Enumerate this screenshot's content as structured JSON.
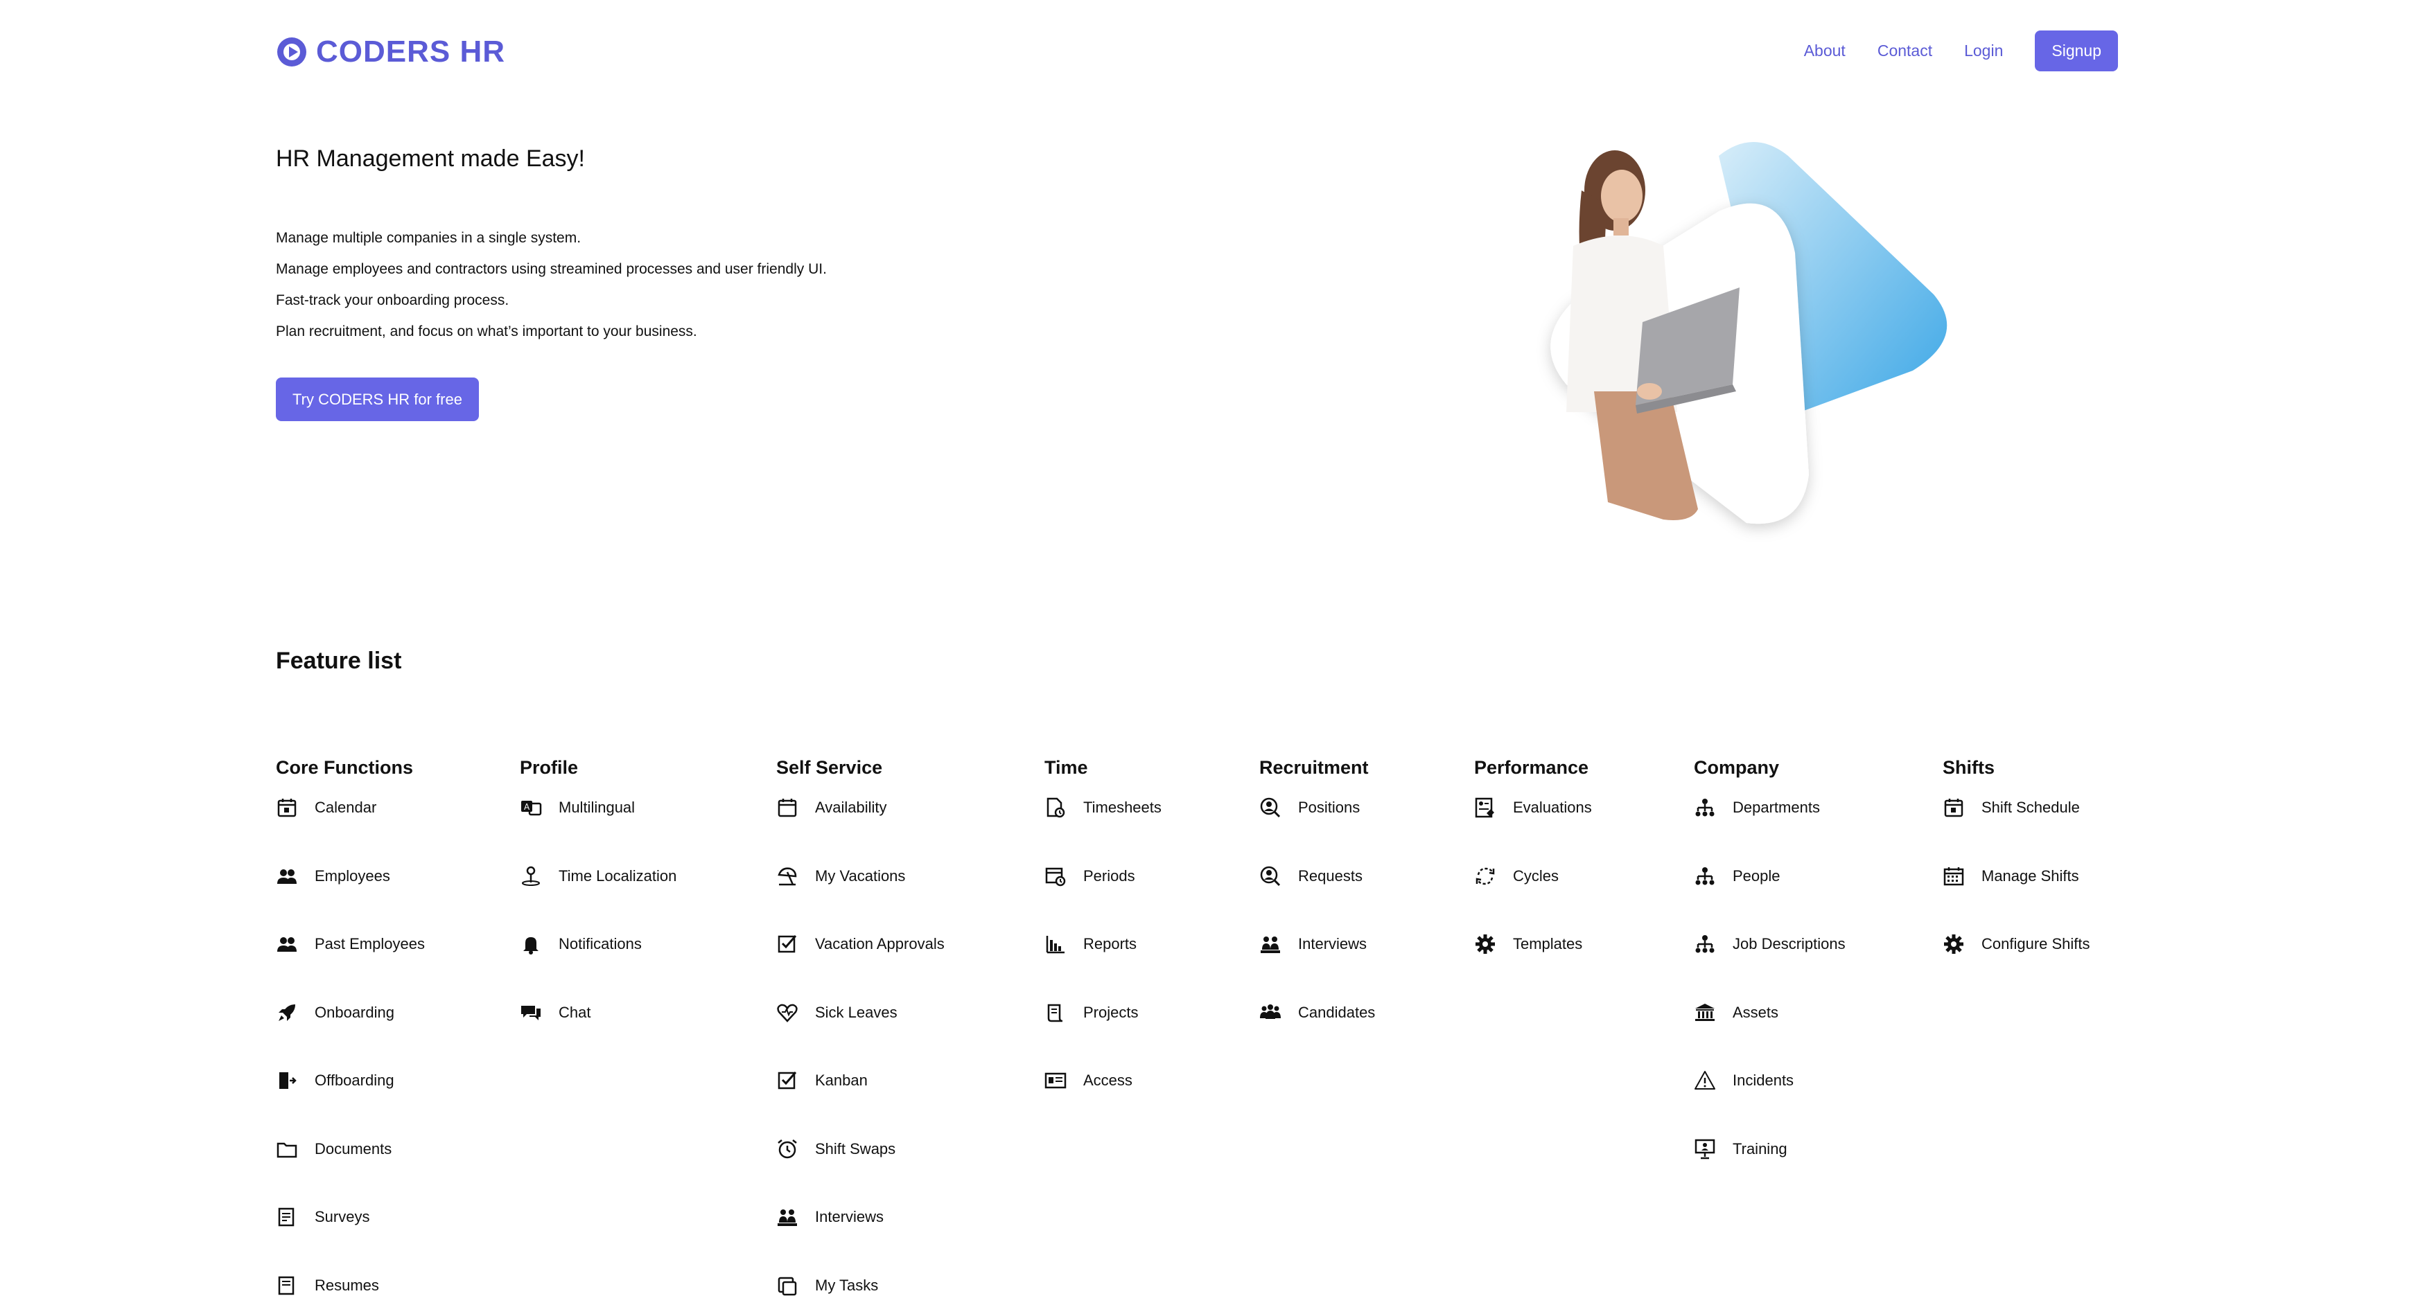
{
  "header": {
    "logo_text": "CODERS HR",
    "nav": [
      {
        "label": "About"
      },
      {
        "label": "Contact"
      },
      {
        "label": "Login"
      }
    ],
    "signup_label": "Signup"
  },
  "hero": {
    "title": "HR Management made Easy!",
    "lines": [
      "Manage multiple companies in a single system.",
      "Manage employees and contractors using streamined processes and user friendly UI.",
      "Fast-track your onboarding process.",
      "Plan recruitment, and focus on what’s important to your business."
    ],
    "cta_label": "Try CODERS HR for free"
  },
  "features": {
    "title": "Feature list",
    "columns": [
      {
        "title": "Core Functions",
        "items": [
          {
            "label": "Calendar",
            "icon": "calendar-icon"
          },
          {
            "label": "Employees",
            "icon": "people-icon"
          },
          {
            "label": "Past Employees",
            "icon": "people-icon"
          },
          {
            "label": "Onboarding",
            "icon": "rocket-icon"
          },
          {
            "label": "Offboarding",
            "icon": "exit-icon"
          },
          {
            "label": "Documents",
            "icon": "folder-icon"
          },
          {
            "label": "Surveys",
            "icon": "survey-icon"
          },
          {
            "label": "Resumes",
            "icon": "document-icon"
          }
        ]
      },
      {
        "title": "Profile",
        "items": [
          {
            "label": "Multilingual",
            "icon": "translate-icon"
          },
          {
            "label": "Time Localization",
            "icon": "location-icon"
          },
          {
            "label": "Notifications",
            "icon": "bell-icon"
          },
          {
            "label": "Chat",
            "icon": "chat-icon"
          }
        ]
      },
      {
        "title": "Self Service",
        "items": [
          {
            "label": "Availability",
            "icon": "calendar-icon"
          },
          {
            "label": "My Vacations",
            "icon": "umbrella-icon"
          },
          {
            "label": "Vacation Approvals",
            "icon": "checkbox-icon"
          },
          {
            "label": "Sick Leaves",
            "icon": "heart-icon"
          },
          {
            "label": "Kanban",
            "icon": "checkbox-icon"
          },
          {
            "label": "Shift Swaps",
            "icon": "alarm-icon"
          },
          {
            "label": "Interviews",
            "icon": "interview-icon"
          },
          {
            "label": "My Tasks",
            "icon": "tasks-icon"
          }
        ]
      },
      {
        "title": "Time",
        "items": [
          {
            "label": "Timesheets",
            "icon": "timesheet-icon"
          },
          {
            "label": "Periods",
            "icon": "calendar-clock-icon"
          },
          {
            "label": "Reports",
            "icon": "bar-chart-icon"
          },
          {
            "label": "Projects",
            "icon": "scroll-icon"
          },
          {
            "label": "Access",
            "icon": "id-card-icon"
          }
        ]
      },
      {
        "title": "Recruitment",
        "items": [
          {
            "label": "Positions",
            "icon": "user-search-icon"
          },
          {
            "label": "Requests",
            "icon": "user-search-icon"
          },
          {
            "label": "Interviews",
            "icon": "interview-icon"
          },
          {
            "label": "Candidates",
            "icon": "group-icon"
          }
        ]
      },
      {
        "title": "Performance",
        "items": [
          {
            "label": "Evaluations",
            "icon": "evaluation-icon"
          },
          {
            "label": "Cycles",
            "icon": "cycle-icon"
          },
          {
            "label": "Templates",
            "icon": "gear-icon"
          }
        ]
      },
      {
        "title": "Company",
        "items": [
          {
            "label": "Departments",
            "icon": "org-chart-icon"
          },
          {
            "label": "People",
            "icon": "org-chart-icon"
          },
          {
            "label": "Job Descriptions",
            "icon": "org-chart-icon"
          },
          {
            "label": "Assets",
            "icon": "bank-icon"
          },
          {
            "label": "Incidents",
            "icon": "warning-icon"
          },
          {
            "label": "Training",
            "icon": "presentation-icon"
          }
        ]
      },
      {
        "title": "Shifts",
        "items": [
          {
            "label": "Shift Schedule",
            "icon": "calendar-icon"
          },
          {
            "label": "Manage Shifts",
            "icon": "calendar-grid-icon"
          },
          {
            "label": "Configure Shifts",
            "icon": "gear-icon"
          }
        ]
      }
    ]
  },
  "colors": {
    "accent": "#6766e6",
    "logo": "#5b5bd6",
    "text": "#111111",
    "shape_gradient_top": "#cfe9f7",
    "shape_gradient_bottom": "#3fa9e8"
  }
}
